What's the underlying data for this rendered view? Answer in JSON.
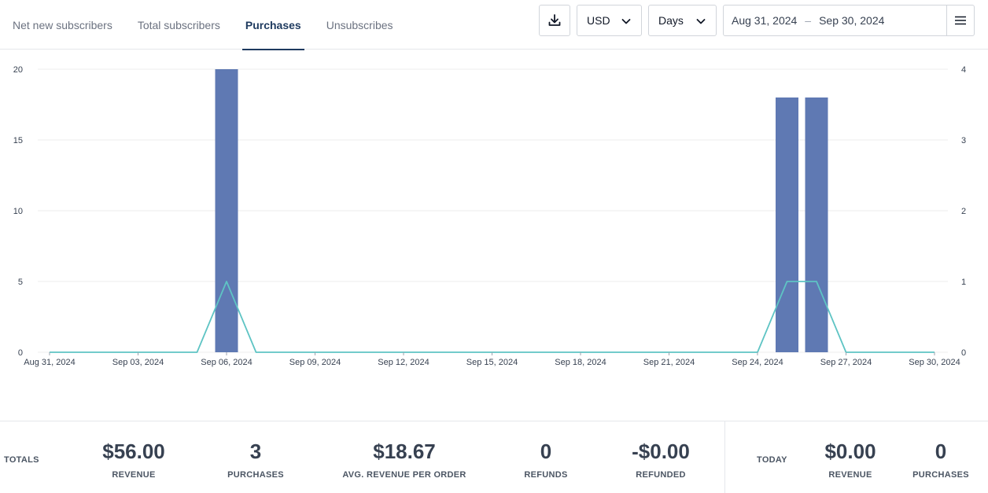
{
  "tabs": [
    {
      "label": "Net new subscribers",
      "active": false
    },
    {
      "label": "Total subscribers",
      "active": false
    },
    {
      "label": "Purchases",
      "active": true
    },
    {
      "label": "Unsubscribes",
      "active": false
    }
  ],
  "controls": {
    "download_icon": "download-icon",
    "currency": "USD",
    "period": "Days",
    "date_start": "Aug 31, 2024",
    "date_separator": "–",
    "date_end": "Sep 30, 2024",
    "menu_icon": "hamburger-menu-icon"
  },
  "colors": {
    "bar": "#5f79b3",
    "line": "#5ec4c4",
    "grid": "#eeeeee",
    "active_tab": "#1e3a5f"
  },
  "chart_data": {
    "type": "bar",
    "x": [
      "2024-08-31",
      "2024-09-01",
      "2024-09-02",
      "2024-09-03",
      "2024-09-04",
      "2024-09-05",
      "2024-09-06",
      "2024-09-07",
      "2024-09-08",
      "2024-09-09",
      "2024-09-10",
      "2024-09-11",
      "2024-09-12",
      "2024-09-13",
      "2024-09-14",
      "2024-09-15",
      "2024-09-16",
      "2024-09-17",
      "2024-09-18",
      "2024-09-19",
      "2024-09-20",
      "2024-09-21",
      "2024-09-22",
      "2024-09-23",
      "2024-09-24",
      "2024-09-25",
      "2024-09-26",
      "2024-09-27",
      "2024-09-28",
      "2024-09-29",
      "2024-09-30"
    ],
    "x_tick_labels": [
      "Aug 31, 2024",
      "Sep 03, 2024",
      "Sep 06, 2024",
      "Sep 09, 2024",
      "Sep 12, 2024",
      "Sep 15, 2024",
      "Sep 18, 2024",
      "Sep 21, 2024",
      "Sep 24, 2024",
      "Sep 27, 2024",
      "Sep 30, 2024"
    ],
    "left_axis": {
      "ylim": [
        0,
        20
      ],
      "ticks": [
        "0",
        "5",
        "10",
        "15",
        "20"
      ]
    },
    "right_axis": {
      "ylim": [
        0,
        4
      ],
      "ticks": [
        "0",
        "1",
        "2",
        "3",
        "4"
      ]
    },
    "series": [
      {
        "type": "bar",
        "axis": "left",
        "values": [
          0,
          0,
          0,
          0,
          0,
          0,
          20,
          0,
          0,
          0,
          0,
          0,
          0,
          0,
          0,
          0,
          0,
          0,
          0,
          0,
          0,
          0,
          0,
          0,
          0,
          18,
          18,
          0,
          0,
          0,
          0
        ]
      },
      {
        "type": "line",
        "axis": "right",
        "values": [
          0,
          0,
          0,
          0,
          0,
          0,
          1,
          0,
          0,
          0,
          0,
          0,
          0,
          0,
          0,
          0,
          0,
          0,
          0,
          0,
          0,
          0,
          0,
          0,
          0,
          1,
          1,
          0,
          0,
          0,
          0
        ]
      }
    ],
    "grid": true
  },
  "totals": {
    "label": "TOTALS",
    "stats": [
      {
        "value": "$56.00",
        "label": "REVENUE"
      },
      {
        "value": "3",
        "label": "PURCHASES"
      },
      {
        "value": "$18.67",
        "label": "AVG. REVENUE PER ORDER"
      },
      {
        "value": "0",
        "label": "REFUNDS"
      },
      {
        "value": "-$0.00",
        "label": "REFUNDED"
      }
    ]
  },
  "today": {
    "label": "TODAY",
    "stats": [
      {
        "value": "$0.00",
        "label": "REVENUE"
      },
      {
        "value": "0",
        "label": "PURCHASES"
      }
    ]
  }
}
